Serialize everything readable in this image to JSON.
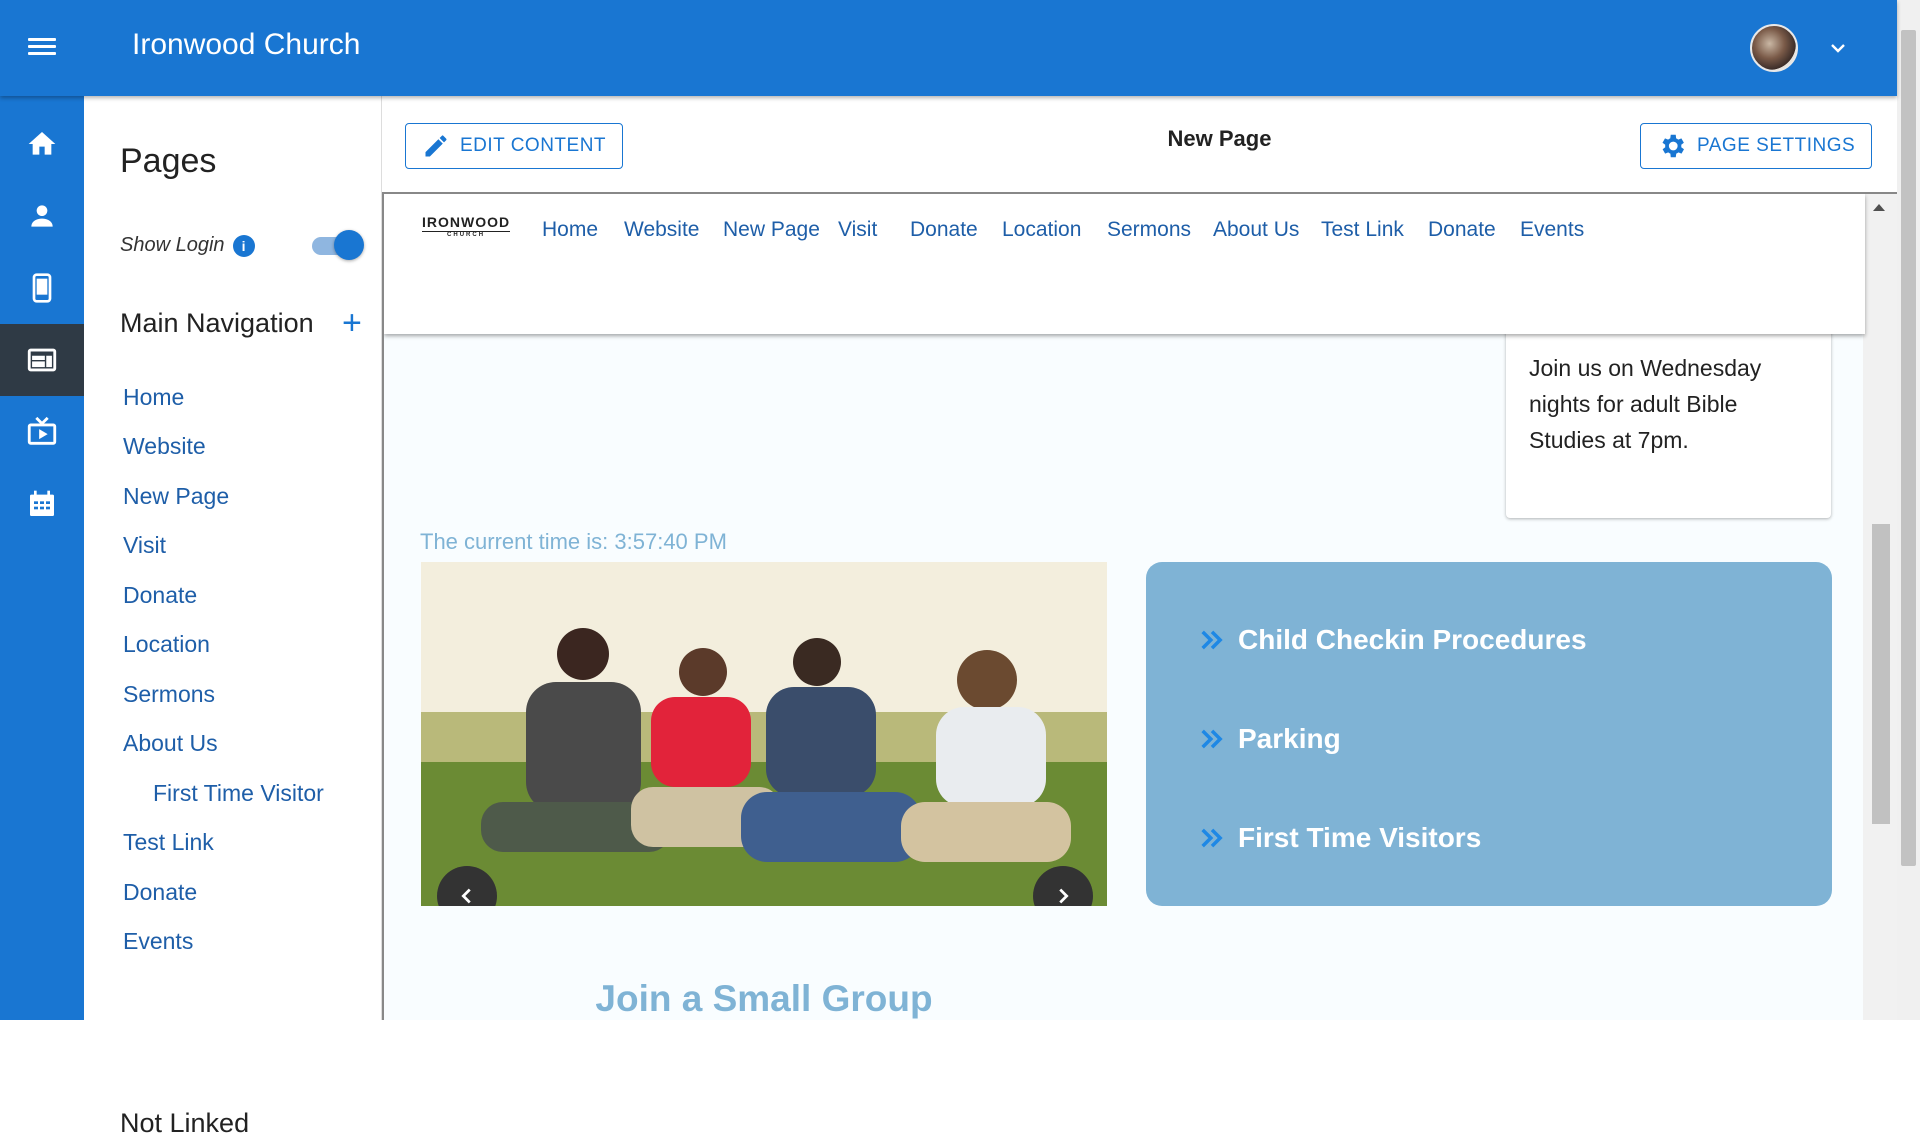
{
  "app": {
    "title": "Ironwood Church"
  },
  "rail": [
    "home-icon",
    "person-icon",
    "mobile-icon",
    "web-icon",
    "live-tv-icon",
    "calendar-icon"
  ],
  "pages": {
    "heading": "Pages",
    "show_login_label": "Show Login",
    "show_login_on": true,
    "main_nav_heading": "Main Navigation",
    "items": [
      {
        "label": "Home",
        "sub": false
      },
      {
        "label": "Website",
        "sub": false
      },
      {
        "label": "New Page",
        "sub": false
      },
      {
        "label": "Visit",
        "sub": false
      },
      {
        "label": "Donate",
        "sub": false
      },
      {
        "label": "Location",
        "sub": false
      },
      {
        "label": "Sermons",
        "sub": false
      },
      {
        "label": "About Us",
        "sub": false
      },
      {
        "label": "First Time Visitor",
        "sub": true
      },
      {
        "label": "Test Link",
        "sub": false
      },
      {
        "label": "Donate",
        "sub": false
      },
      {
        "label": "Events",
        "sub": false
      }
    ],
    "not_linked_heading": "Not Linked"
  },
  "toolbar": {
    "edit_label": "EDIT CONTENT",
    "page_title": "New Page",
    "settings_label": "PAGE SETTINGS"
  },
  "site": {
    "logo_main": "IRONWOOD",
    "logo_sub": "CHURCH",
    "nav": [
      "Home",
      "Website",
      "New Page",
      "Visit",
      "Donate",
      "Location",
      "Sermons",
      "About Us",
      "Test Link",
      "Donate",
      "Events"
    ],
    "card_text": "Join us on Wednesday nights for adult Bible Studies at 7pm.",
    "time_text": "The current time is: 3:57:40 PM",
    "links": [
      "Child Checkin Procedures",
      "Parking",
      "First Time Visitors"
    ],
    "small_group_title": "Join a Small Group"
  },
  "colors": {
    "primary": "#1976d2",
    "accent_light": "#7fb3d5",
    "link_arrow": "#1e88e5"
  }
}
